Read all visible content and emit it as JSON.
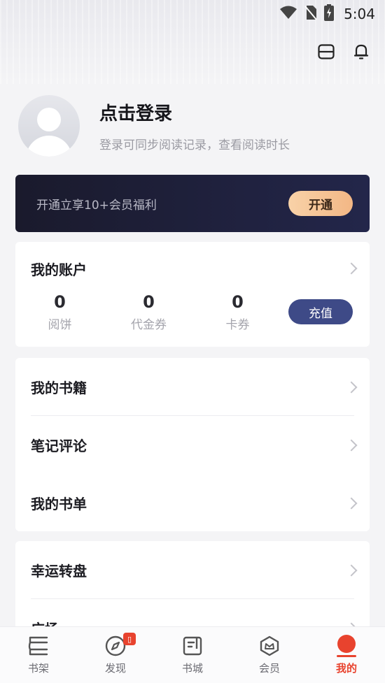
{
  "status_bar": {
    "time": "5:04",
    "icons": [
      "wifi-icon",
      "no-sim-icon",
      "battery-charging-icon"
    ]
  },
  "header": {
    "icons": [
      "scan-icon",
      "bell-icon"
    ]
  },
  "profile": {
    "title": "点击登录",
    "subtitle": "登录可同步阅读记录，查看阅读时长"
  },
  "vip_banner": {
    "text": "开通立享10+会员福利",
    "button": "开通"
  },
  "account": {
    "title": "我的账户",
    "stats": [
      {
        "value": "0",
        "label": "阅饼"
      },
      {
        "value": "0",
        "label": "代金券"
      },
      {
        "value": "0",
        "label": "卡券"
      }
    ],
    "button": "充值"
  },
  "books_menu": [
    {
      "label": "我的书籍"
    },
    {
      "label": "笔记评论"
    },
    {
      "label": "我的书单"
    }
  ],
  "more_menu": [
    {
      "label": "幸运转盘"
    },
    {
      "label": "广场"
    }
  ],
  "tabbar": [
    {
      "label": "书架",
      "icon": "bookshelf-icon"
    },
    {
      "label": "发现",
      "icon": "compass-icon",
      "badge": "📖"
    },
    {
      "label": "书城",
      "icon": "bookstore-icon"
    },
    {
      "label": "会员",
      "icon": "vip-crown-icon"
    },
    {
      "label": "我的",
      "icon": "profile-dot-icon",
      "active": true
    }
  ],
  "colors": {
    "accent": "#e8432e",
    "vip_dark": "#1a1a2c",
    "recharge": "#3e4a87",
    "vip_gold": "#f3b785"
  }
}
